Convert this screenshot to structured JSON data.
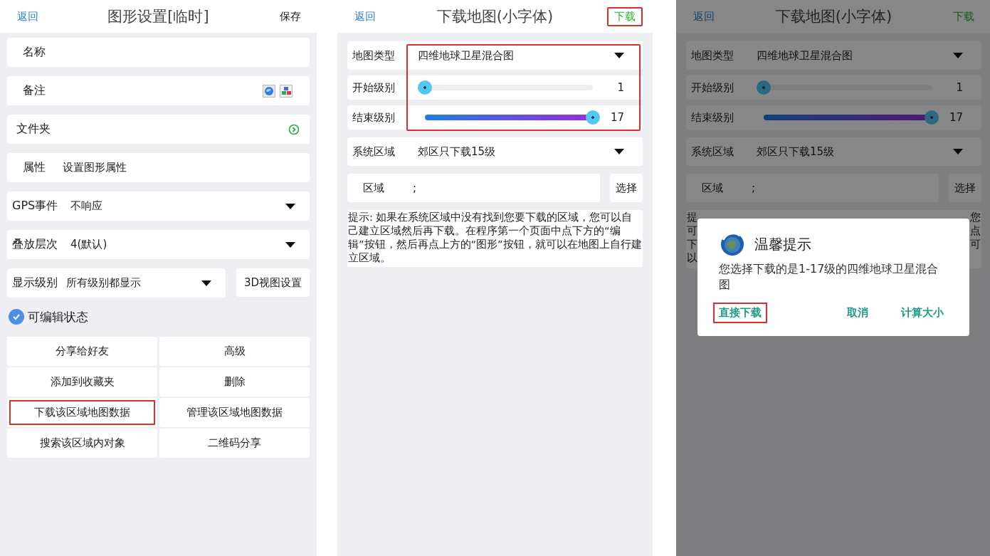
{
  "shape_settings": {
    "header": {
      "back": "返回",
      "title": "图形设置[临时]",
      "action": "保存",
      "action_highlighted": false
    },
    "fields": [
      {
        "kind": "text",
        "label": "名称"
      },
      {
        "kind": "icons",
        "label": "备注"
      },
      {
        "kind": "link",
        "label": "文件夹"
      },
      {
        "kind": "value",
        "label": "属性",
        "value": "设置图形属性"
      },
      {
        "kind": "dropdown",
        "label": "GPS事件",
        "value": "不响应"
      },
      {
        "kind": "dropdown",
        "label": "叠放层次",
        "value": "4(默认)"
      }
    ],
    "display_level": {
      "label": "显示级别",
      "value": "所有级别都显示"
    },
    "view3d_button": "3D视图设置",
    "editable": {
      "label": "可编辑状态",
      "checked": true
    },
    "actions": [
      {
        "label": "分享给好友",
        "highlighted": false
      },
      {
        "label": "高级",
        "highlighted": false
      },
      {
        "label": "添加到收藏夹",
        "highlighted": false
      },
      {
        "label": "删除",
        "highlighted": false
      },
      {
        "label": "下载该区域地图数据",
        "highlighted": true
      },
      {
        "label": "管理该区域地图数据",
        "highlighted": false
      },
      {
        "label": "搜索该区域内对象",
        "highlighted": false
      },
      {
        "label": "二维码分享",
        "highlighted": false
      }
    ]
  },
  "download_map": {
    "dimmed": false,
    "header": {
      "back": "返回",
      "title": "下载地图(小字体)",
      "action": "下载",
      "action_highlighted": true
    },
    "settings_highlighted": true,
    "map_type": {
      "label": "地图类型",
      "value": "四维地球卫星混合图"
    },
    "sliders": [
      {
        "label": "开始级别",
        "level": 0,
        "reading": "1"
      },
      {
        "label": "结束级别",
        "level": 1,
        "reading": "17"
      }
    ],
    "system_area": {
      "label": "系统区域",
      "value": "郊区只下载15级"
    },
    "area": {
      "label": "区域",
      "value": ";",
      "button": "选择"
    },
    "hint": "提示: 如果在系统区域中没有找到您要下载的区域，您可以自己建立区域然后再下载。在程序第一个页面中点下方的“编辑”按钮，然后再点上方的“图形”按钮，就可以在地图上自行建立区域。"
  },
  "download_map_dialog": {
    "dimmed": true,
    "header": {
      "back": "返回",
      "title": "下载地图(小字体)",
      "action": "下载",
      "action_highlighted": false
    },
    "settings_highlighted": false,
    "map_type": {
      "label": "地图类型",
      "value": "四维地球卫星混合图"
    },
    "sliders": [
      {
        "label": "开始级别",
        "level": 0,
        "reading": "1"
      },
      {
        "label": "结束级别",
        "level": 1,
        "reading": "17"
      }
    ],
    "system_area": {
      "label": "系统区域",
      "value": "郊区只下载15级"
    },
    "area": {
      "label": "区域",
      "value": ";",
      "button": "选择"
    },
    "hint_fragments": {
      "left": [
        "提",
        "可",
        "下",
        "以"
      ],
      "right": [
        "您",
        "点",
        "可"
      ]
    },
    "dialog": {
      "title": "温馨提示",
      "message": "您选择下载的是1-17级的四维地球卫星混合图",
      "buttons": [
        {
          "label": "直接下载",
          "highlighted": true
        },
        {
          "label": "取消",
          "highlighted": false
        },
        {
          "label": "计算大小",
          "highlighted": false
        }
      ]
    }
  }
}
